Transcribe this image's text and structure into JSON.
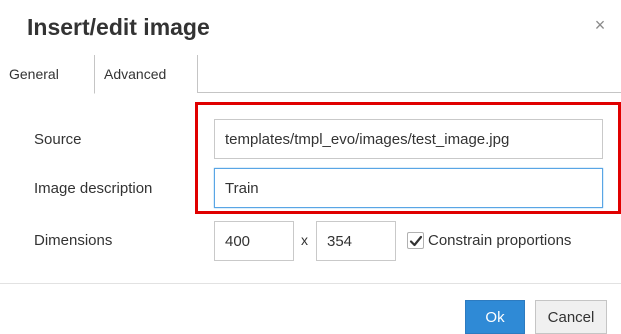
{
  "dialog": {
    "title": "Insert/edit image",
    "close_symbol": "×"
  },
  "tabs": [
    {
      "label": "General",
      "active": true
    },
    {
      "label": "Advanced",
      "active": false
    }
  ],
  "fields": {
    "source": {
      "label": "Source",
      "value": "templates/tmpl_evo/images/test_image.jpg"
    },
    "description": {
      "label": "Image description",
      "value": "Train"
    },
    "dimensions": {
      "label": "Dimensions",
      "width": "400",
      "separator": "x",
      "height": "354"
    }
  },
  "constrain": {
    "label": "Constrain proportions",
    "checked": true
  },
  "buttons": {
    "ok": "Ok",
    "cancel": "Cancel"
  },
  "colors": {
    "accent": "#2f8ad6",
    "highlight_box": "#e00000",
    "focus_border": "#59a5e5"
  },
  "icons": {
    "close": "close-icon",
    "check": "checkmark-icon"
  }
}
